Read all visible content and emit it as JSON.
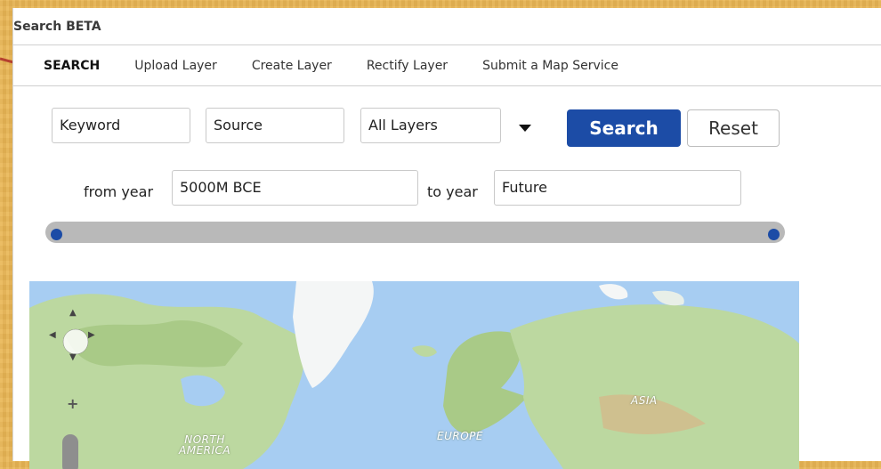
{
  "window": {
    "title": "Search BETA"
  },
  "tabs": [
    {
      "label": "SEARCH",
      "active": true
    },
    {
      "label": "Upload Layer"
    },
    {
      "label": "Create Layer"
    },
    {
      "label": "Rectify Layer"
    },
    {
      "label": "Submit a Map Service"
    }
  ],
  "search": {
    "keyword_value": "Keyword",
    "source_value": "Source",
    "layers_value": "All Layers",
    "search_label": "Search",
    "reset_label": "Reset",
    "from_year_label": "from year",
    "from_year_value": "5000M BCE",
    "to_year_label": "to year",
    "to_year_value": "Future"
  },
  "time_slider": {
    "start_fraction": 0.0,
    "end_fraction": 1.0
  },
  "map": {
    "labels": {
      "asia": "ASIA",
      "europe": "EUROPE",
      "north_america": "NORTH\nAMERICA"
    },
    "colors": {
      "ocean": "#a7cdf2",
      "land": "#bcd8a0",
      "ice": "#f4f6f6"
    }
  },
  "colors": {
    "accent": "#1c4ca6",
    "background": "#e9b655",
    "annotation_arrow": "#b5402f"
  }
}
